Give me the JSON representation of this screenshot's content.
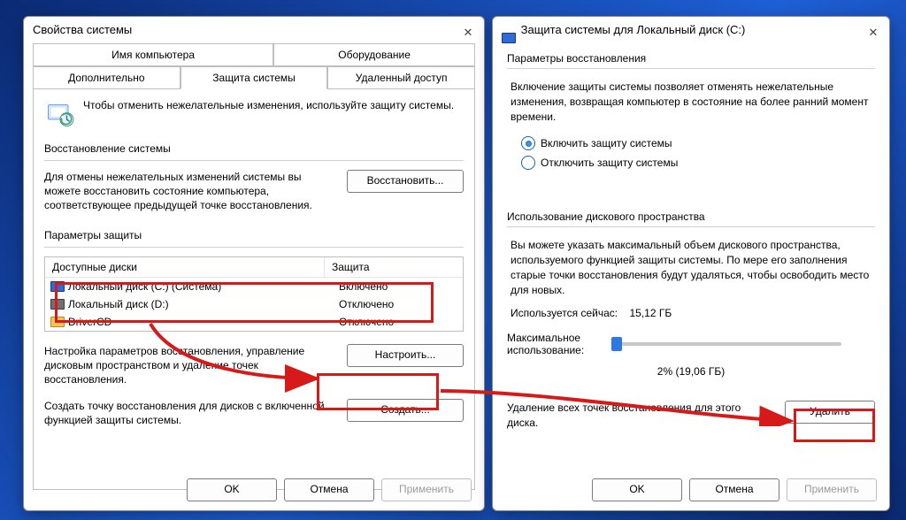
{
  "dlg1": {
    "title": "Свойства системы",
    "tabs_row1": [
      "Имя компьютера",
      "Оборудование"
    ],
    "tabs_row2": [
      "Дополнительно",
      "Защита системы",
      "Удаленный доступ"
    ],
    "intro": "Чтобы отменить нежелательные изменения, используйте защиту системы.",
    "section_restore": "Восстановление системы",
    "restore_desc": "Для отмены нежелательных изменений системы вы можете восстановить состояние компьютера, соответствующее предыдущей точке восстановления.",
    "btn_restore": "Восстановить...",
    "section_params": "Параметры защиты",
    "col_drives": "Доступные диски",
    "col_protection": "Защита",
    "drives": [
      {
        "name": "Локальный диск (C:) (Система)",
        "status": "Включено",
        "icon": "hdd"
      },
      {
        "name": "Локальный диск (D:)",
        "status": "Отключено",
        "icon": "hdd-grey"
      },
      {
        "name": "DriverCD",
        "status": "Отключено",
        "icon": "folder"
      }
    ],
    "cfg_desc": "Настройка параметров восстановления, управление дисковым пространством и удаление точек восстановления.",
    "btn_configure": "Настроить...",
    "create_desc": "Создать точку восстановления для дисков с включенной функцией защиты системы.",
    "btn_create": "Создать...",
    "btn_ok": "OK",
    "btn_cancel": "Отмена",
    "btn_apply": "Применить"
  },
  "dlg2": {
    "title": "Защита системы для Локальный диск (C:)",
    "section_params": "Параметры восстановления",
    "params_desc": "Включение защиты системы позволяет отменять нежелательные изменения, возвращая компьютер в состояние на более ранний момент времени.",
    "radio_on": "Включить защиту системы",
    "radio_off": "Отключить защиту системы",
    "section_disk": "Использование дискового пространства",
    "disk_desc": "Вы можете указать максимальный объем дискового пространства, используемого функцией защиты системы. По мере его заполнения старые точки восстановления будут удаляться, чтобы освободить место для новых.",
    "used_label": "Используется сейчас:",
    "used_value": "15,12 ГБ",
    "max_label": "Максимальное использование:",
    "max_value": "2% (19,06 ГБ)",
    "delete_desc": "Удаление всех точек восстановления для этого диска.",
    "btn_delete": "Удалить",
    "btn_ok": "OK",
    "btn_cancel": "Отмена",
    "btn_apply": "Применить"
  }
}
